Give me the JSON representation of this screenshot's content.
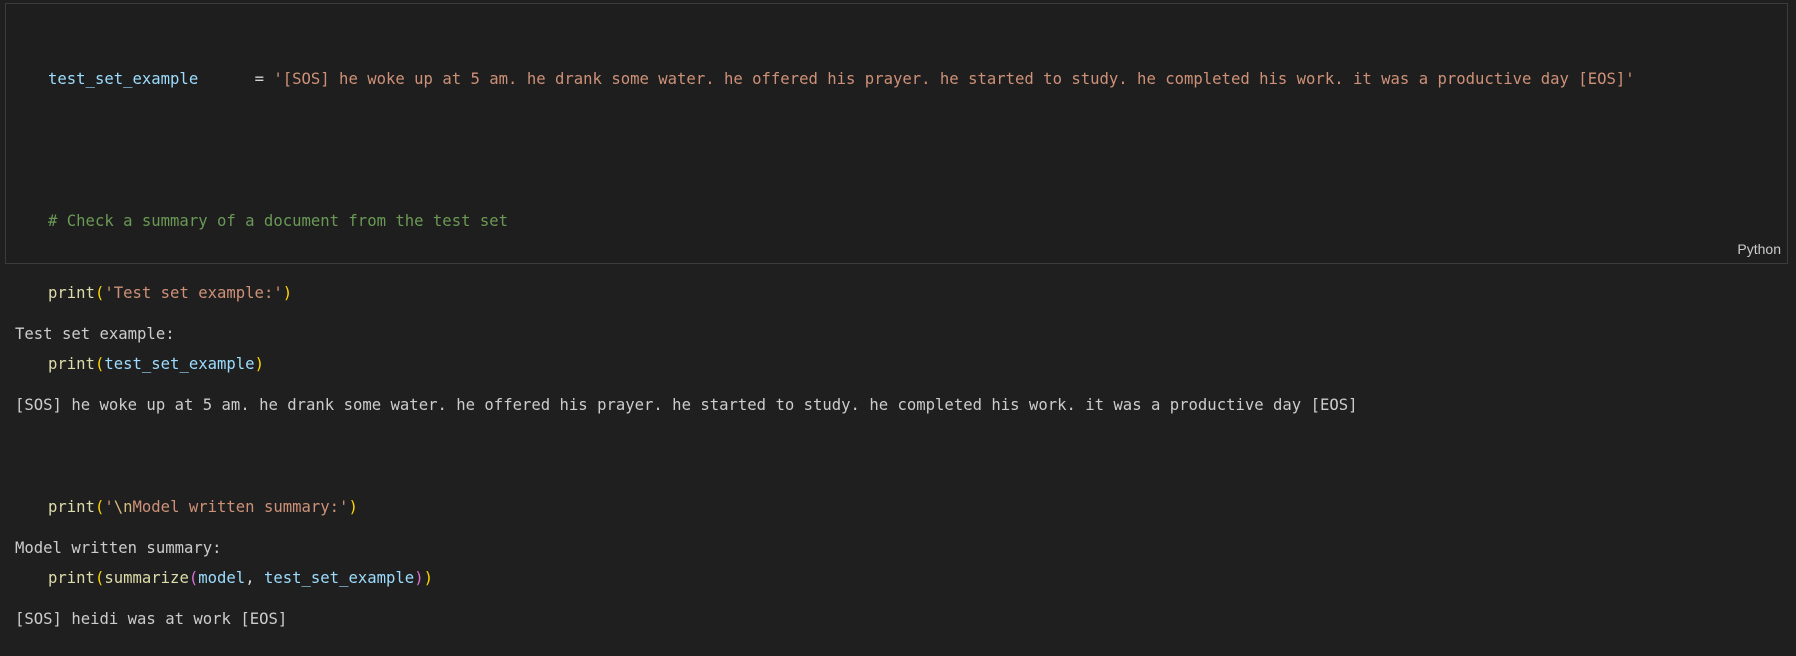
{
  "cell": {
    "language": "Python",
    "code": {
      "line1": {
        "var": "test_set_example",
        "pad": "      ",
        "eq": "= ",
        "str": "'[SOS] he woke up at 5 am. he drank some water. he offered his prayer. he started to study. he completed his work. it was a productive day [EOS]'"
      },
      "line3": "# Check a summary of a document from the test set",
      "line4": {
        "fn": "print",
        "open": "(",
        "str": "'Test set example:'",
        "close": ")"
      },
      "line5": {
        "fn": "print",
        "open": "(",
        "var": "test_set_example",
        "close": ")"
      },
      "line7": {
        "fn": "print",
        "open": "(",
        "str_a": "'",
        "esc": "\\n",
        "str_b": "Model written summary:'",
        "close": ")"
      },
      "line8": {
        "fn": "print",
        "open": "(",
        "fn2": "summarize",
        "open2": "(",
        "arg1": "model",
        "comma": ", ",
        "arg2": "test_set_example",
        "close2": ")",
        "close": ")"
      }
    }
  },
  "output": {
    "lines": [
      "Test set example:",
      "[SOS] he woke up at 5 am. he drank some water. he offered his prayer. he started to study. he completed his work. it was a productive day [EOS]",
      "",
      "Model written summary:",
      "[SOS] heidi was at work [EOS]"
    ]
  },
  "colors": {
    "background": "#1f1f1f",
    "variable": "#9cdcfe",
    "string": "#ce9178",
    "comment": "#6a9955",
    "function": "#dcdcaa",
    "bracket_level1": "#ffd700",
    "bracket_level2": "#da70d6"
  }
}
